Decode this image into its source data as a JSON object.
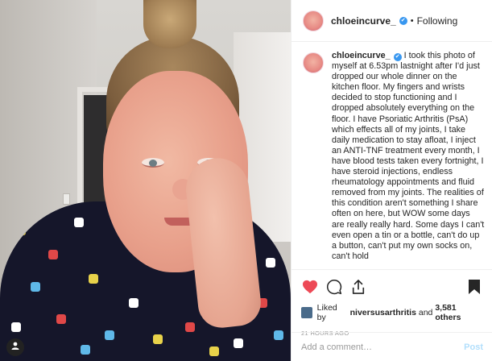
{
  "post": {
    "username": "chloeincurve_",
    "follow_status": "Following",
    "separator": "•",
    "verified_mark": "✔",
    "caption": "I took this photo of myself at 6.53pm lastnight after I'd just dropped our whole dinner on the kitchen floor. My fingers and wrists decided to stop functioning and I dropped absolutely everything on the floor. I have Psoriatic Arthritis (PsA) which effects all of my joints, I take daily medication to stay afloat, I inject an ANTI-TNF treatment every month, I have blood tests taken every fortnight, I have steroid injections, endless rheumatology appointments and fluid removed from my joints. The realities of this condition aren't something I share often on here, but WOW some days are really really hard. Some days I can't even open a tin or a bottle, can't do up a button, can't put my own socks on, can't hold",
    "likes_prefix": "Liked by",
    "likes_user": "niversusarthritis",
    "likes_connector": "and",
    "likes_others": "3,581 others",
    "timestamp": "21 HOURS AGO"
  },
  "comment": {
    "placeholder": "Add a comment…",
    "post_label": "Post"
  },
  "icons": {
    "like": "heart-icon",
    "comment": "comment-icon",
    "share": "share-icon",
    "save": "bookmark-icon",
    "photo_badge": "user-tag-icon"
  },
  "colors": {
    "like_red": "#ed4956",
    "verified_blue": "#3897f0",
    "post_button_disabled": "#b2dffc",
    "muted_text": "#999999"
  }
}
